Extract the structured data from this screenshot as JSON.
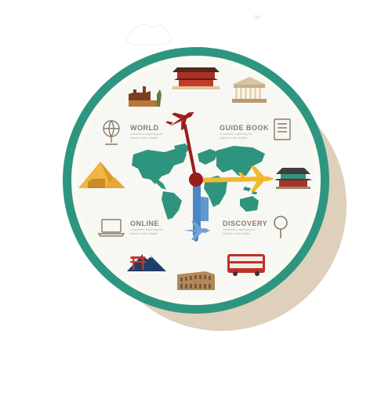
{
  "colors": {
    "ring": "#2e9680",
    "face": "#f7f8f3",
    "shadow": "#dfd0bb",
    "map_green": "#2f947d",
    "map_blue": "#4a86c5",
    "label_text": "#8a7b69",
    "hand_red": "#9b1c1c",
    "plane_yellow": "#f1b82f",
    "plane_blue": "#6ea3d4"
  },
  "labels": {
    "world": "WORLD",
    "guide_book": "GUIDE BOOK",
    "online": "ONLINE",
    "discovery": "DISCOVERY"
  },
  "sublines": {
    "world": [
      "consectetur adipiscing elit,",
      "quisque mollis fringilla."
    ],
    "guide_book": [
      "consectetur adipiscing elit,",
      "quisque mollis fringilla."
    ],
    "online": [
      "consectetur adipiscing elit,",
      "quisque mollis fringilla."
    ],
    "discovery": [
      "consectetur adipiscing elit,",
      "quisque mollis fringilla."
    ]
  },
  "icons": [
    "great-wall-icon",
    "forbidden-city-icon",
    "parthenon-icon",
    "globe-icon",
    "book-icon",
    "pyramids-sphinx-icon",
    "korean-palace-icon",
    "laptop-icon",
    "magnifier-icon",
    "mount-fuji-torii-icon",
    "colosseum-icon",
    "double-decker-bus-icon",
    "world-map-icon",
    "red-plane-icon",
    "yellow-plane-icon",
    "blue-plane-icon"
  ]
}
